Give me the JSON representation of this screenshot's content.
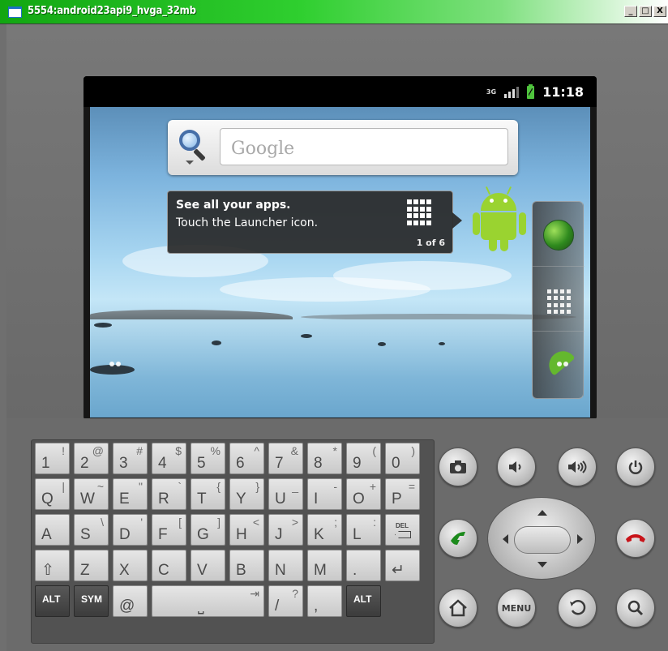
{
  "window": {
    "title": "5554:android23api9_hvga_32mb",
    "minimize": "_",
    "maximize": "□",
    "close": "X"
  },
  "status_bar": {
    "network": "3G",
    "time": "11:18"
  },
  "search": {
    "placeholder": "Google"
  },
  "tip": {
    "title": "See all your apps.",
    "body": "Touch the Launcher icon.",
    "page": "1 of 6"
  },
  "keyboard": {
    "rows": [
      [
        {
          "main": "1",
          "alt": "!"
        },
        {
          "main": "2",
          "alt": "@"
        },
        {
          "main": "3",
          "alt": "#"
        },
        {
          "main": "4",
          "alt": "$"
        },
        {
          "main": "5",
          "alt": "%"
        },
        {
          "main": "6",
          "alt": "^"
        },
        {
          "main": "7",
          "alt": "&"
        },
        {
          "main": "8",
          "alt": "*"
        },
        {
          "main": "9",
          "alt": "("
        },
        {
          "main": "0",
          "alt": ")"
        }
      ],
      [
        {
          "main": "Q",
          "alt": "|"
        },
        {
          "main": "W",
          "alt": "~"
        },
        {
          "main": "E",
          "alt": "\""
        },
        {
          "main": "R",
          "alt": "`"
        },
        {
          "main": "T",
          "alt": "{"
        },
        {
          "main": "Y",
          "alt": "}"
        },
        {
          "main": "U",
          "alt": "_"
        },
        {
          "main": "I",
          "alt": "-"
        },
        {
          "main": "O",
          "alt": "+"
        },
        {
          "main": "P",
          "alt": "="
        }
      ],
      [
        {
          "main": "A",
          "alt": ""
        },
        {
          "main": "S",
          "alt": "\\"
        },
        {
          "main": "D",
          "alt": "'"
        },
        {
          "main": "F",
          "alt": "["
        },
        {
          "main": "G",
          "alt": "]"
        },
        {
          "main": "H",
          "alt": "<"
        },
        {
          "main": "J",
          "alt": ">"
        },
        {
          "main": "K",
          "alt": ";"
        },
        {
          "main": "L",
          "alt": ":"
        },
        {
          "main": "",
          "alt": "",
          "special": "DEL"
        }
      ],
      [
        {
          "main": "⇧",
          "alt": ""
        },
        {
          "main": "Z",
          "alt": ""
        },
        {
          "main": "X",
          "alt": ""
        },
        {
          "main": "C",
          "alt": ""
        },
        {
          "main": "V",
          "alt": ""
        },
        {
          "main": "B",
          "alt": ""
        },
        {
          "main": "N",
          "alt": ""
        },
        {
          "main": "M",
          "alt": ""
        },
        {
          "main": ".",
          "alt": ""
        },
        {
          "main": "↵",
          "alt": ""
        }
      ]
    ],
    "bottom": {
      "alt_left": "ALT",
      "sym": "SYM",
      "at": "@",
      "space_glyph": "⎵",
      "tab": "⇥",
      "slash": "/",
      "question": "?",
      "comma": ",",
      "alt_right": "ALT"
    },
    "del_label": "DEL"
  },
  "hardware": {
    "menu_label": "MENU"
  }
}
